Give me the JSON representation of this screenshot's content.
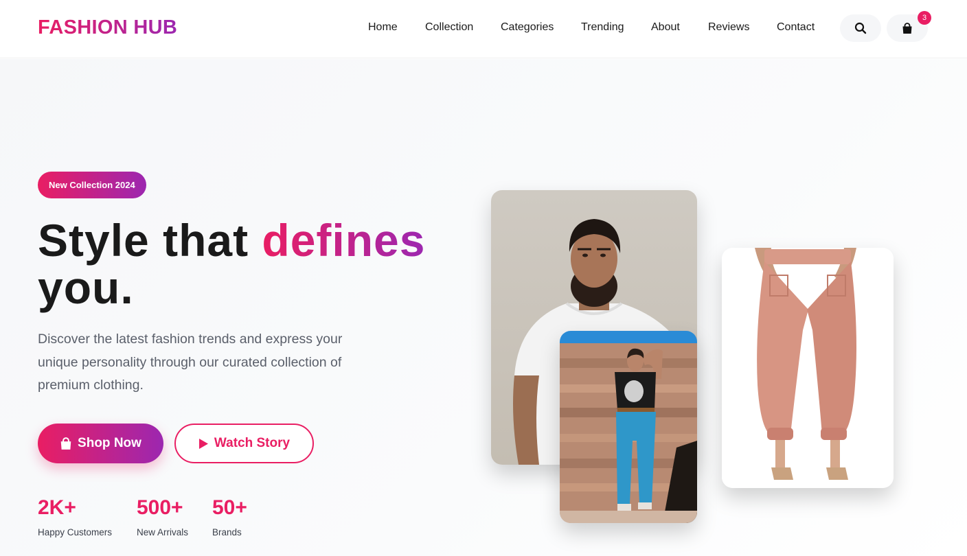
{
  "brand": {
    "logo": "FASHION HUB",
    "accent_start": "#e91e63",
    "accent_end": "#9c27b0"
  },
  "nav": {
    "items": [
      {
        "label": "Home"
      },
      {
        "label": "Collection"
      },
      {
        "label": "Categories"
      },
      {
        "label": "Trending"
      },
      {
        "label": "About"
      },
      {
        "label": "Reviews"
      },
      {
        "label": "Contact"
      }
    ],
    "search_icon": "search-icon",
    "cart_icon": "shopping-bag-icon",
    "cart_count": "3"
  },
  "hero": {
    "badge": "New Collection 2024",
    "headline_part1": "Style that ",
    "headline_accent": "defines",
    "headline_part2": "you.",
    "description": "Discover the latest fashion trends and express your unique personality through our curated collection of premium clothing.",
    "primary_button": "Shop Now",
    "primary_icon": "shopping-bag-icon",
    "secondary_button": "Watch Story",
    "secondary_icon": "play-icon"
  },
  "stats": [
    {
      "value": "2K+",
      "label": "Happy Customers"
    },
    {
      "value": "500+",
      "label": "New Arrivals"
    },
    {
      "value": "50+",
      "label": "Brands"
    }
  ],
  "images": [
    {
      "name": "man-white-tshirt-photo"
    },
    {
      "name": "woman-denim-jeans-photo"
    },
    {
      "name": "pink-pants-photo"
    }
  ]
}
